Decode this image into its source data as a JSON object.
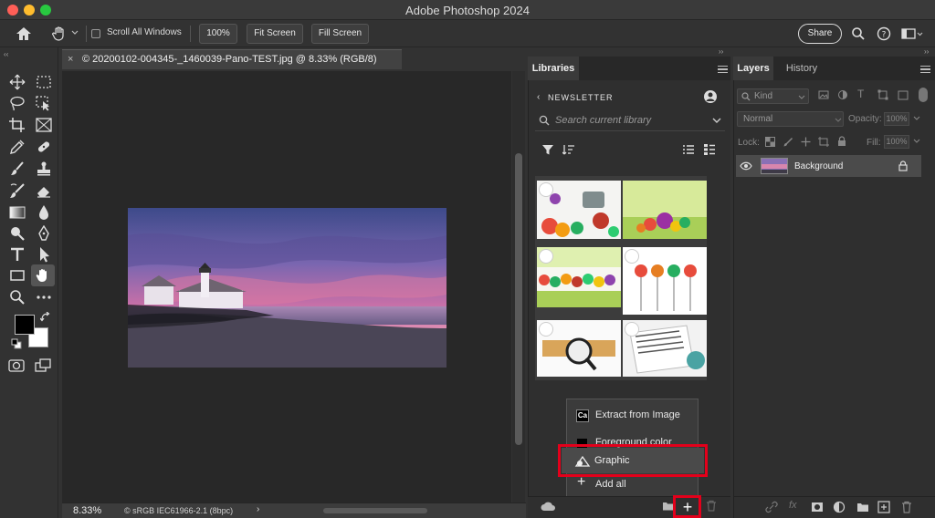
{
  "window": {
    "title": "Adobe Photoshop 2024"
  },
  "options_bar": {
    "scroll_all_label": "Scroll All Windows",
    "zoom_100_label": "100%",
    "fit_screen_label": "Fit Screen",
    "fill_screen_label": "Fill Screen",
    "share_label": "Share",
    "icons": [
      "home-icon",
      "hand-icon",
      "chevron-down-icon",
      "search-icon",
      "help-icon",
      "workspace-icon"
    ]
  },
  "document": {
    "tab_title": "© 20200102-004345-_1460039-Pano-TEST.jpg @ 8.33% (RGB/8)",
    "close_glyph": "×"
  },
  "status_bar": {
    "zoom": "8.33%",
    "profile": "© sRGB IEC61966-2.1 (8bpc)",
    "arrow": "›"
  },
  "libraries": {
    "tab_label": "Libraries",
    "back_glyph": "‹",
    "library_name": "NEWSLETTER",
    "search_placeholder": "Search current library",
    "thumbnails": [
      "food-collage-1",
      "vegetables-bowl",
      "fruit-vegetable-banner",
      "vegetables-on-forks",
      "nutrition-label-bar",
      "nutrition-facts-label"
    ],
    "menu": {
      "extract_label": "Extract from Image",
      "extract_badge": "Ca",
      "foreground_label": "Foreground color",
      "graphic_label": "Graphic",
      "add_all_label": "Add all",
      "add_all_glyph": "+"
    }
  },
  "layers": {
    "tab_layers": "Layers",
    "tab_history": "History",
    "kind_label": "Kind",
    "blend_mode": "Normal",
    "opacity_label": "Opacity:",
    "opacity_value": "100%",
    "lock_label": "Lock:",
    "fill_label": "Fill:",
    "fill_value": "100%",
    "layer_name": "Background"
  },
  "colors": {
    "highlight_red": "#e3001b",
    "foreground": "#000000",
    "background": "#ffffff"
  }
}
